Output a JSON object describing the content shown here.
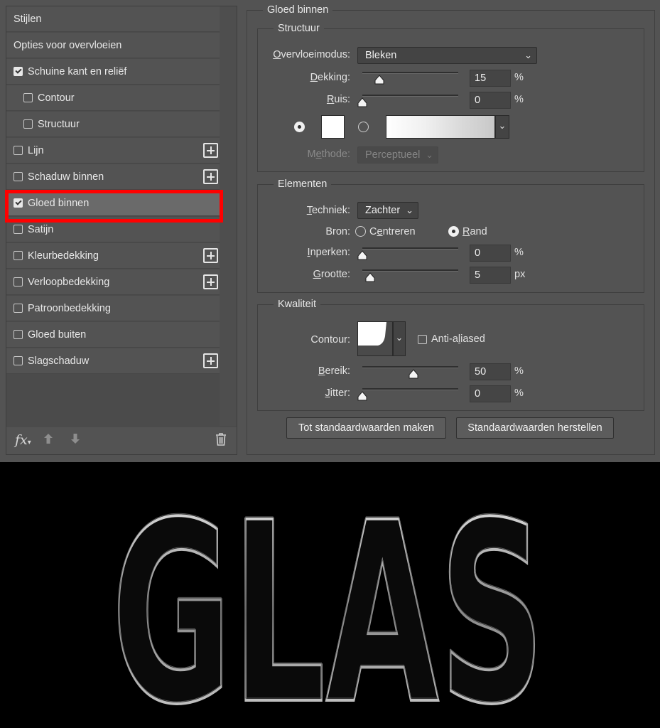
{
  "style_list": {
    "items": [
      {
        "label": "Stijlen",
        "checkbox": false,
        "checked": false,
        "indent": false,
        "plus": false,
        "selected": false
      },
      {
        "label": "Opties voor overvloeien",
        "checkbox": false,
        "checked": false,
        "indent": false,
        "plus": false,
        "selected": false
      },
      {
        "label": "Schuine kant en reliëf",
        "checkbox": true,
        "checked": true,
        "indent": false,
        "plus": false,
        "selected": false
      },
      {
        "label": "Contour",
        "checkbox": true,
        "checked": false,
        "indent": true,
        "plus": false,
        "selected": false
      },
      {
        "label": "Structuur",
        "checkbox": true,
        "checked": false,
        "indent": true,
        "plus": false,
        "selected": false
      },
      {
        "label": "Lijn",
        "checkbox": true,
        "checked": false,
        "indent": false,
        "plus": true,
        "selected": false
      },
      {
        "label": "Schaduw binnen",
        "checkbox": true,
        "checked": false,
        "indent": false,
        "plus": true,
        "selected": false
      },
      {
        "label": "Gloed binnen",
        "checkbox": true,
        "checked": true,
        "indent": false,
        "plus": false,
        "selected": true
      },
      {
        "label": "Satijn",
        "checkbox": true,
        "checked": false,
        "indent": false,
        "plus": false,
        "selected": false
      },
      {
        "label": "Kleurbedekking",
        "checkbox": true,
        "checked": false,
        "indent": false,
        "plus": true,
        "selected": false
      },
      {
        "label": "Verloopbedekking",
        "checkbox": true,
        "checked": false,
        "indent": false,
        "plus": true,
        "selected": false
      },
      {
        "label": "Patroonbedekking",
        "checkbox": true,
        "checked": false,
        "indent": false,
        "plus": false,
        "selected": false
      },
      {
        "label": "Gloed buiten",
        "checkbox": true,
        "checked": false,
        "indent": false,
        "plus": false,
        "selected": false
      },
      {
        "label": "Slagschaduw",
        "checkbox": true,
        "checked": false,
        "indent": false,
        "plus": true,
        "selected": false
      }
    ],
    "footer": {
      "fx_label": "fx",
      "icons": [
        "fx-icon",
        "arrow-up-icon",
        "arrow-down-icon",
        "trash-icon"
      ]
    }
  },
  "panel": {
    "title": "Gloed binnen",
    "structuur": {
      "title": "Structuur",
      "blend_mode_label": "Overvloeimodus:",
      "blend_mode_value": "Bleken",
      "opacity_label": "Dekking:",
      "opacity_value": "15",
      "opacity_unit": "%",
      "noise_label": "Ruis:",
      "noise_value": "0",
      "noise_unit": "%",
      "method_label": "Methode:",
      "method_value": "Perceptueel",
      "color_swatch": "#ffffff",
      "color_mode": "solid color"
    },
    "elementen": {
      "title": "Elementen",
      "technique_label": "Techniek:",
      "technique_value": "Zachter",
      "source_label": "Bron:",
      "source_center": "Centreren",
      "source_edge": "Rand",
      "source_selected": "Rand",
      "choke_label": "Inperken:",
      "choke_value": "0",
      "choke_unit": "%",
      "size_label": "Grootte:",
      "size_value": "5",
      "size_unit": "px"
    },
    "kwaliteit": {
      "title": "Kwaliteit",
      "contour_label": "Contour:",
      "antialias_label": "Anti-aliased",
      "antialias_checked": false,
      "range_label": "Bereik:",
      "range_value": "50",
      "range_unit": "%",
      "jitter_label": "Jitter:",
      "jitter_value": "0",
      "jitter_unit": "%"
    },
    "buttons": {
      "make_default": "Tot standaardwaarden maken",
      "reset_default": "Standaardwaarden herstellen"
    }
  },
  "sliders": {
    "opacity": 0.15,
    "noise": 0.0,
    "choke": 0.0,
    "size": 0.05,
    "range": 0.5,
    "jitter": 0.0
  },
  "preview": {
    "text": "GLAS",
    "background": "#000000",
    "stroke_color": "#d8d8d8"
  },
  "colors": {
    "dialog_bg": "#535353",
    "selection_highlight": "#ff0000"
  }
}
